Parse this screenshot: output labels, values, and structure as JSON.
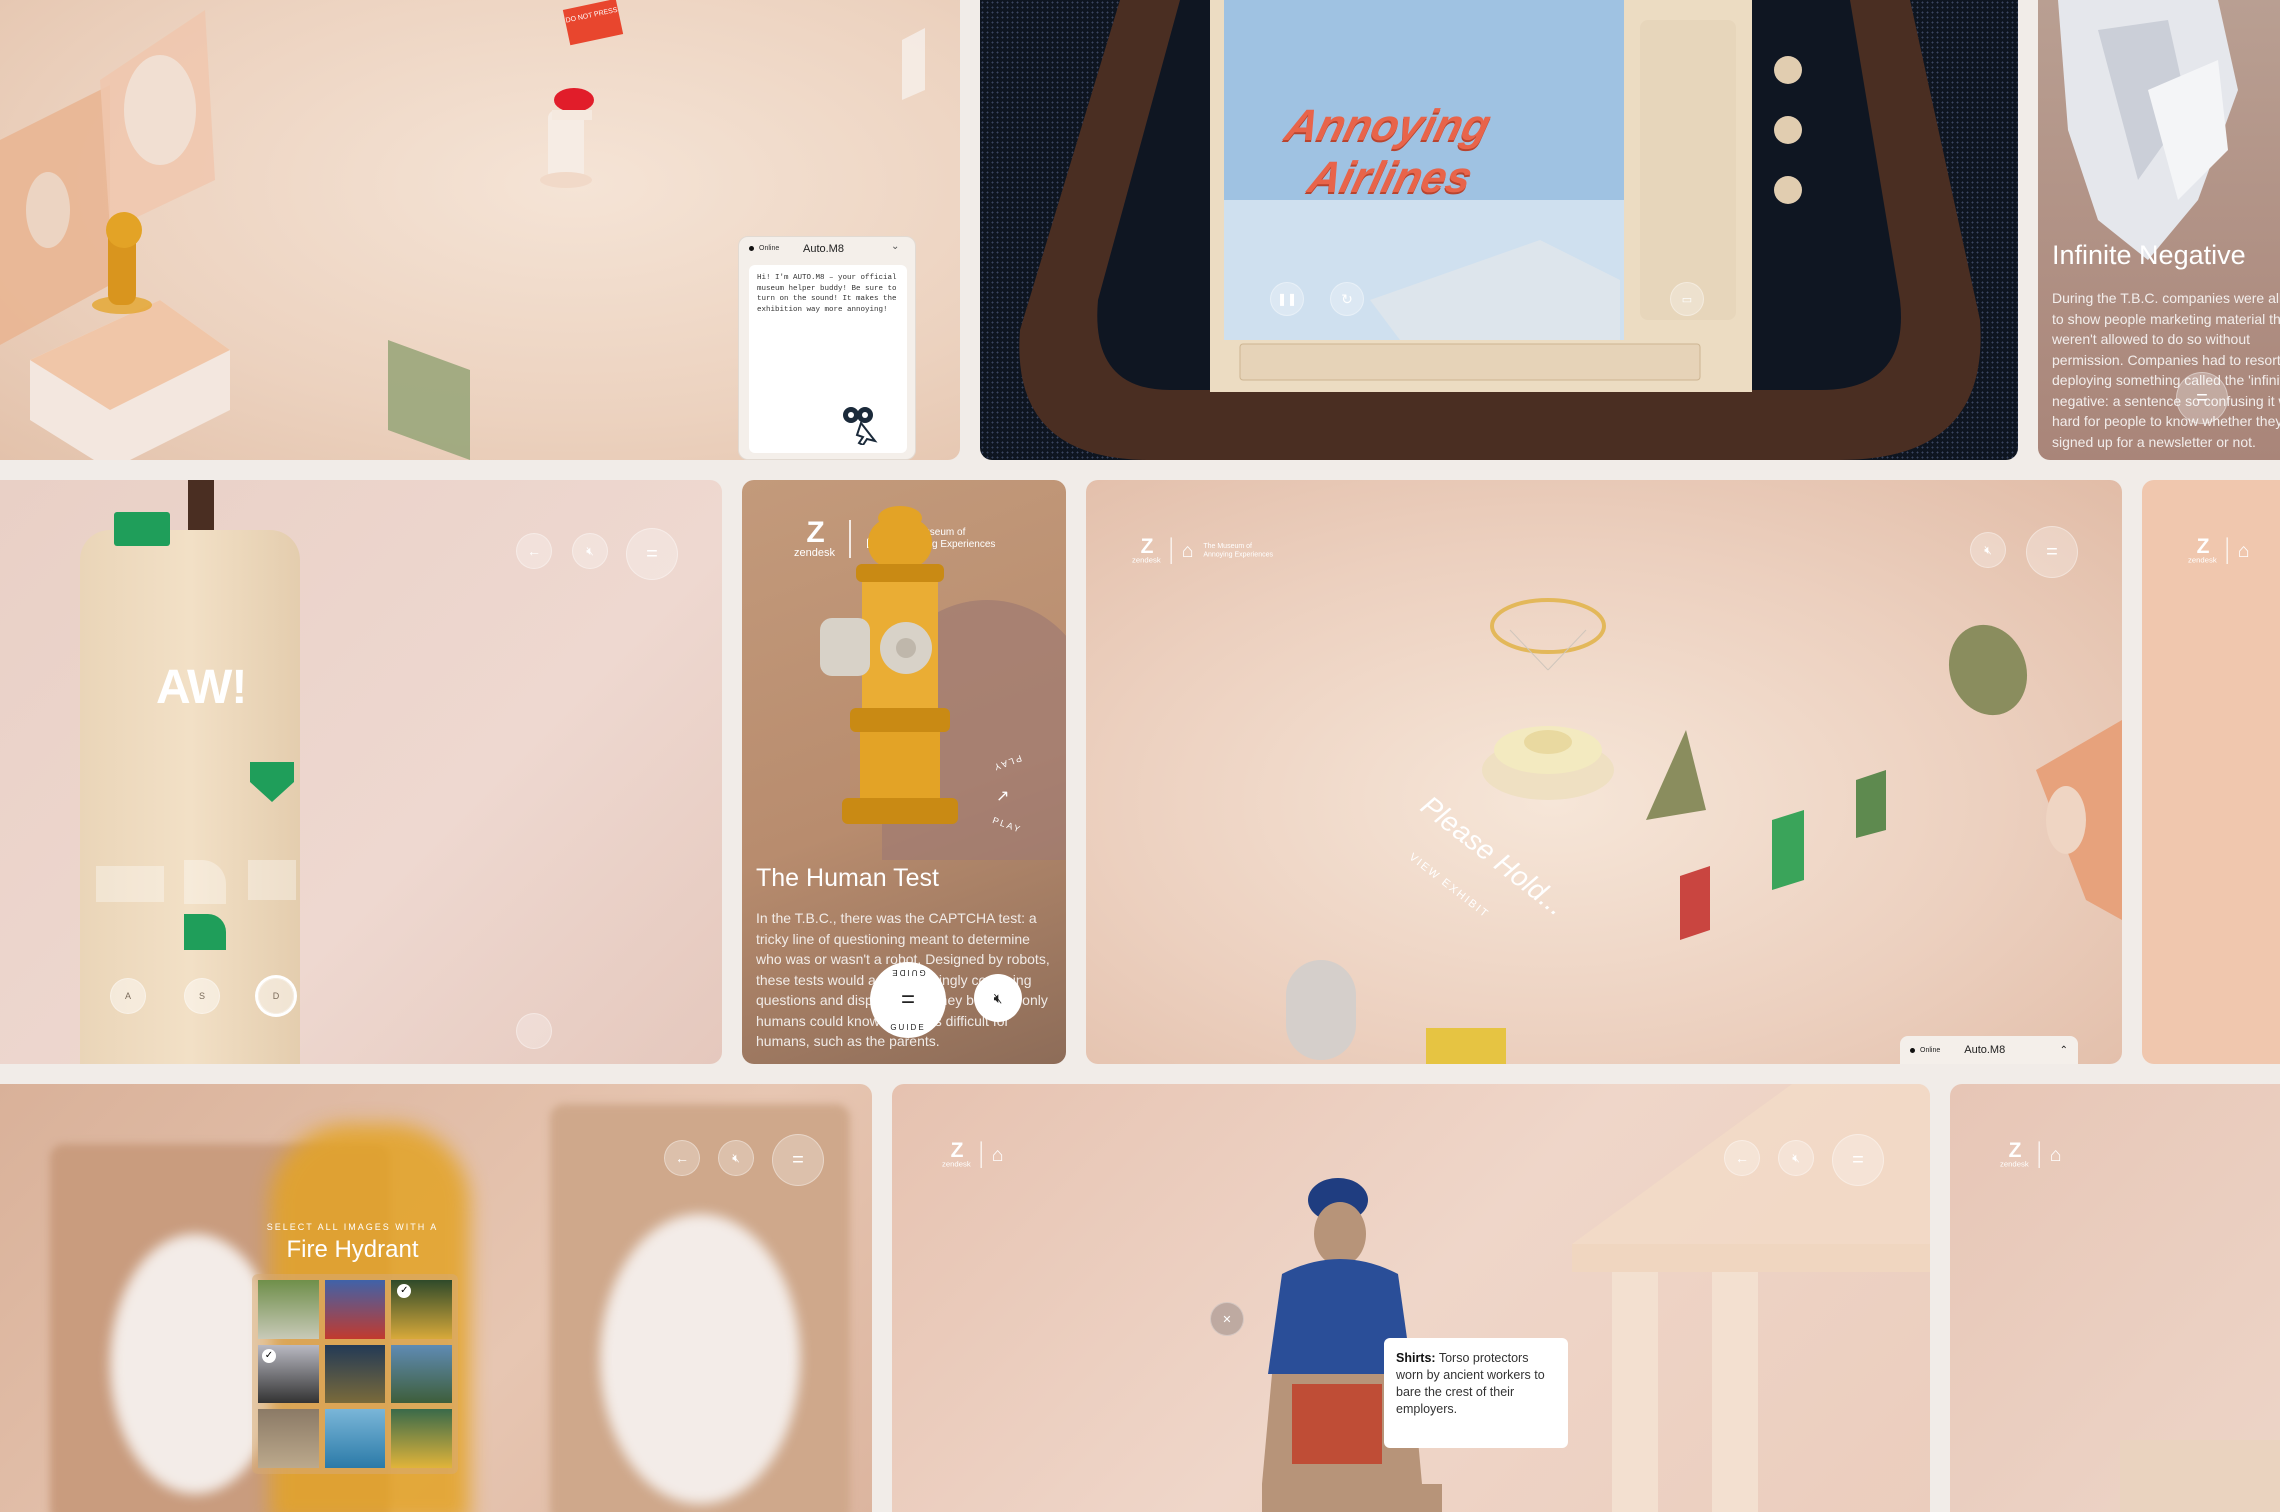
{
  "colors": {
    "accent_green": "#1f9e5a",
    "hydrant": "#e3a326",
    "peach": "#f0c7ae",
    "dark_brown": "#4a2e22",
    "airline_orange": "#e8644a"
  },
  "tile1": {
    "sign": "DO NOT PRESS",
    "chat": {
      "status": "Online",
      "name": "Auto.M8",
      "message": "Hi! I'm AUTO.M8 – your official museum helper buddy! Be sure to turn on the sound! It makes the exhibition way more annoying!"
    }
  },
  "tile2": {
    "title_line1": "Annoying",
    "title_line2": "Airlines"
  },
  "tile3": {
    "title": "Infinite Negative",
    "body": "During the T.B.C. companies were allowed to show people marketing material they weren't allowed to do so without permission. Companies had to resort to deploying something called the 'infinite negative: a sentence so confusing it was hard for people to know whether they'd signed up for a newsletter or not."
  },
  "tile4": {
    "aw": "AW!",
    "keys": [
      "A",
      "S",
      "D"
    ]
  },
  "tile5": {
    "brand": "zendesk",
    "museum": "The Museum of Annoying Experiences",
    "title": "The Human Test",
    "body": "In the T.B.C., there was the CAPTCHA test: a tricky line of questioning meant to determine who was or wasn't a robot. Designed by robots, these tests would ask increasingly confusing questions and display things they believed only humans could know. This was difficult for humans, such as the parents.",
    "play": "PLAY",
    "guide_top": "GUIDE",
    "guide_bottom": "GUIDE"
  },
  "tile6": {
    "brand": "zendesk",
    "museum": "The Museum of Annoying Experiences",
    "hold": "Please Hold...",
    "view": "VIEW EXHIBIT",
    "chat_status": "Online",
    "chat_name": "Auto.M8"
  },
  "tile7": {
    "brand": "zendesk"
  },
  "tile8": {
    "subtitle": "SELECT ALL IMAGES WITH A",
    "title": "Fire Hydrant"
  },
  "tile9": {
    "brand": "zendesk",
    "caption_bold": "Shirts:",
    "caption": " Torso protectors worn by ancient workers to bare the crest of their employers."
  },
  "tile10": {
    "brand": "zendesk"
  }
}
